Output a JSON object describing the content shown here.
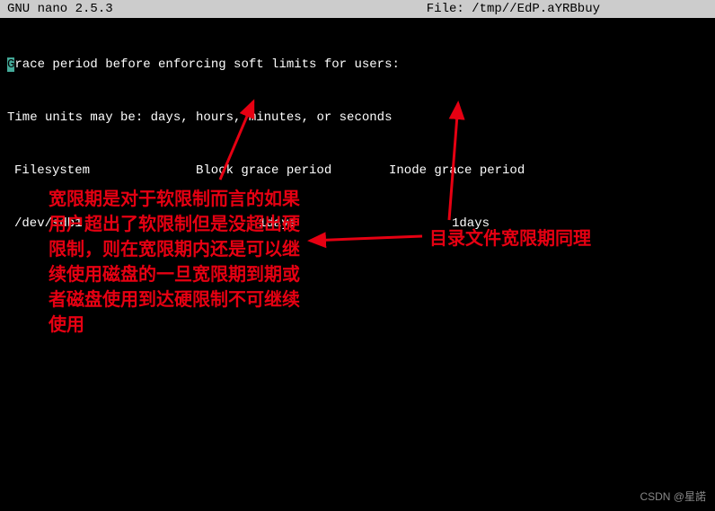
{
  "titlebar": {
    "app": "GNU nano  2.5.3",
    "file_label": "File: /tmp//EdP.aYRBbuy"
  },
  "terminal": {
    "line1_first_char": "G",
    "line1_rest": "race period before enforcing soft limits for users:",
    "line2": "Time units may be: days, hours, minutes, or seconds",
    "headers": {
      "col1": "Filesystem",
      "col2": "Block grace period",
      "col3": "Inode grace period"
    },
    "values": {
      "col1": "/dev/sdb1",
      "col2": "1days",
      "col3": "1days"
    }
  },
  "annotations": {
    "left": "宽限期是对于软限制而言的如果用户超出了软限制但是没超出硬限制，则在宽限期内还是可以继续使用磁盘的一旦宽限期到期或者磁盘使用到达硬限制不可继续使用",
    "right": "目录文件宽限期同理"
  },
  "watermark": "CSDN @星諾"
}
